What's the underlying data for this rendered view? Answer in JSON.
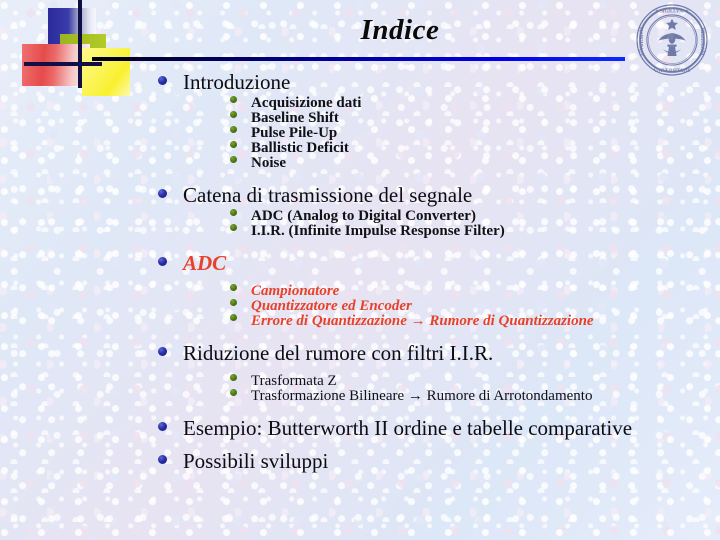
{
  "slide": {
    "title": "Indice",
    "logo_name": "university-seal",
    "accent_colors": {
      "title_text": "#0a0a0a",
      "rule_left": "#000018",
      "rule_right": "#0b2bff",
      "level1_bullet": "#2a2fa8",
      "level2_bullet": "#4f7a17",
      "highlight_red": "#e8412a",
      "background": "#dce6f5"
    },
    "decorations": [
      {
        "name": "blue-square",
        "color": "#2b2b9c"
      },
      {
        "name": "green-square",
        "color": "#a8c022"
      },
      {
        "name": "red-square",
        "color": "#e64b4b"
      },
      {
        "name": "yellow-square",
        "color": "#f9f02e"
      },
      {
        "name": "vertical-line",
        "color": "#101045"
      },
      {
        "name": "horizontal-line",
        "color": "#101045"
      }
    ],
    "outline": [
      {
        "label": "Introduzione",
        "style": "normal",
        "children": [
          {
            "label": "Acquisizione dati",
            "style": "bold"
          },
          {
            "label": "Baseline Shift",
            "style": "bold"
          },
          {
            "label": "Pulse Pile-Up",
            "style": "bold"
          },
          {
            "label": "Ballistic Deficit",
            "style": "bold"
          },
          {
            "label": "Noise",
            "style": "bold"
          }
        ]
      },
      {
        "label": "Catena di trasmissione del segnale",
        "style": "normal",
        "children": [
          {
            "label": "ADC (Analog to Digital Converter)",
            "style": "bold"
          },
          {
            "label": "I.I.R. (Infinite Impulse Response Filter)",
            "style": "bold"
          }
        ]
      },
      {
        "label": "ADC",
        "style": "red-bold-italic",
        "children": [
          {
            "label": "Campionatore",
            "style": "red-bold-italic"
          },
          {
            "label": "Quantizzatore ed Encoder",
            "style": "red-bold-italic"
          },
          {
            "label": "Errore di Quantizzazione → Rumore di Quantizzazione",
            "style": "red-bold-italic"
          }
        ]
      },
      {
        "label": "Riduzione del rumore con filtri I.I.R.",
        "style": "normal",
        "children": [
          {
            "label": "Trasformata Z",
            "style": "normal"
          },
          {
            "label": "Trasformazione Bilineare → Rumore di Arrotondamento",
            "style": "normal"
          }
        ]
      },
      {
        "label": "Esempio: Butterworth II ordine e tabelle comparative",
        "style": "normal",
        "children": []
      },
      {
        "label": "Possibili sviluppi",
        "style": "normal",
        "children": []
      }
    ]
  }
}
